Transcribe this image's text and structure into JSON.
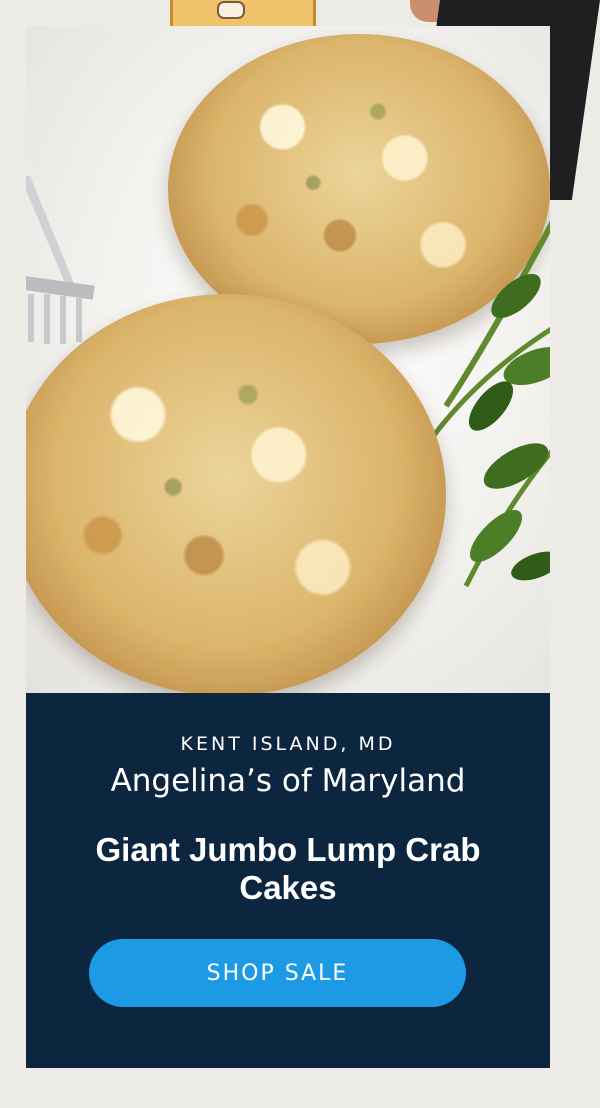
{
  "promo": {
    "location": "KENT ISLAND, MD",
    "vendor": "Angelina’s of Maryland",
    "product": "Giant Jumbo Lump Crab Cakes",
    "cta_label": "SHOP SALE"
  },
  "colors": {
    "card_background": "#0d2640",
    "page_background": "#ecebe6",
    "cta_background": "#1d9ae6",
    "text": "#ffffff"
  },
  "image": {
    "subject": "crab-cakes-photo"
  }
}
